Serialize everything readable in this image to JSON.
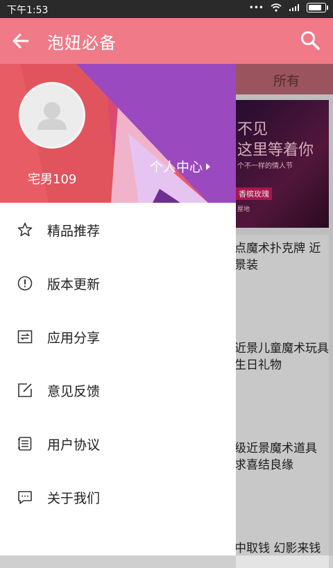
{
  "status_bar": {
    "time": "下午1:53"
  },
  "app_bar": {
    "title": "泡妞必备"
  },
  "background": {
    "tab_label": "所有",
    "banner_lines": [
      "不见",
      "这里等着你",
      "个不一样的情人节",
      "香槟玫瑰",
      "屋地"
    ],
    "cards": [
      "点魔术扑克牌 近景装",
      "近景儿童魔术玩具生日礼物",
      "级近景魔术道具 求喜结良缘",
      "中取钱 幻影来钱"
    ]
  },
  "drawer": {
    "username": "宅男109",
    "profile_link": "个人中心",
    "menu": [
      {
        "label": "精品推荐",
        "icon": "star-icon"
      },
      {
        "label": "版本更新",
        "icon": "info-icon"
      },
      {
        "label": "应用分享",
        "icon": "share-icon"
      },
      {
        "label": "意见反馈",
        "icon": "edit-icon"
      },
      {
        "label": "用户协议",
        "icon": "document-icon"
      },
      {
        "label": "关于我们",
        "icon": "chat-icon"
      }
    ]
  },
  "colors": {
    "app_bar": "#f07a88",
    "header_red": "#e85c65",
    "header_purple": "#9b49be",
    "status_bar": "#2a2a2a"
  }
}
